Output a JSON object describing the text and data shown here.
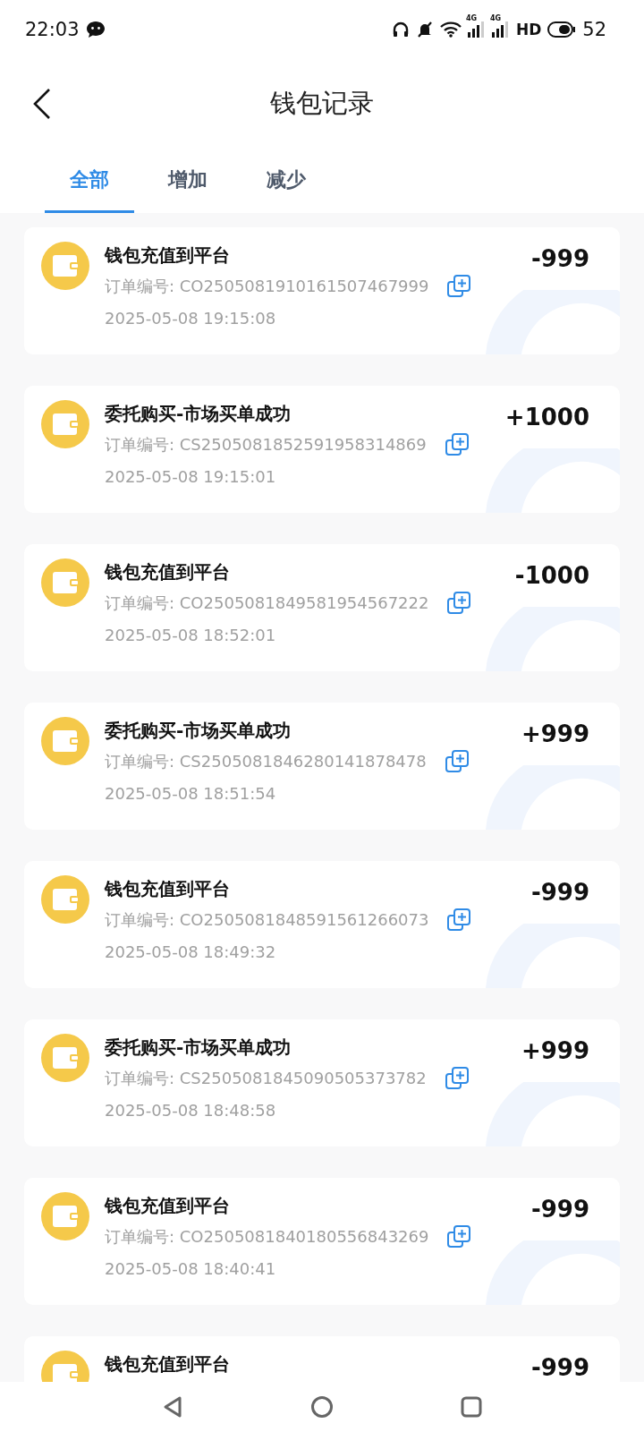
{
  "status_bar": {
    "time": "22:03",
    "network_labels": [
      "4G",
      "4G"
    ],
    "hd_label": "HD",
    "battery": "52"
  },
  "header": {
    "title": "钱包记录"
  },
  "tabs": [
    {
      "label": "全部",
      "selected": true
    },
    {
      "label": "增加",
      "selected": false
    },
    {
      "label": "减少",
      "selected": false
    }
  ],
  "records": [
    {
      "title": "钱包充值到平台",
      "order_label": "订单编号:",
      "order_no": "CO2505081910161507467999",
      "time": "2025-05-08 19:15:08",
      "amount": "-999"
    },
    {
      "title": "委托购买-市场买单成功",
      "order_label": "订单编号:",
      "order_no": "CS2505081852591958314869",
      "time": "2025-05-08 19:15:01",
      "amount": "+1000"
    },
    {
      "title": "钱包充值到平台",
      "order_label": "订单编号:",
      "order_no": "CO2505081849581954567222",
      "time": "2025-05-08 18:52:01",
      "amount": "-1000"
    },
    {
      "title": "委托购买-市场买单成功",
      "order_label": "订单编号:",
      "order_no": "CS2505081846280141878478",
      "time": "2025-05-08 18:51:54",
      "amount": "+999"
    },
    {
      "title": "钱包充值到平台",
      "order_label": "订单编号:",
      "order_no": "CO2505081848591561266073",
      "time": "2025-05-08 18:49:32",
      "amount": "-999"
    },
    {
      "title": "委托购买-市场买单成功",
      "order_label": "订单编号:",
      "order_no": "CS2505081845090505373782",
      "time": "2025-05-08 18:48:58",
      "amount": "+999"
    },
    {
      "title": "钱包充值到平台",
      "order_label": "订单编号:",
      "order_no": "CO2505081840180556843269",
      "time": "2025-05-08 18:40:41",
      "amount": "-999"
    },
    {
      "title": "钱包充值到平台",
      "amount": "-999"
    }
  ]
}
